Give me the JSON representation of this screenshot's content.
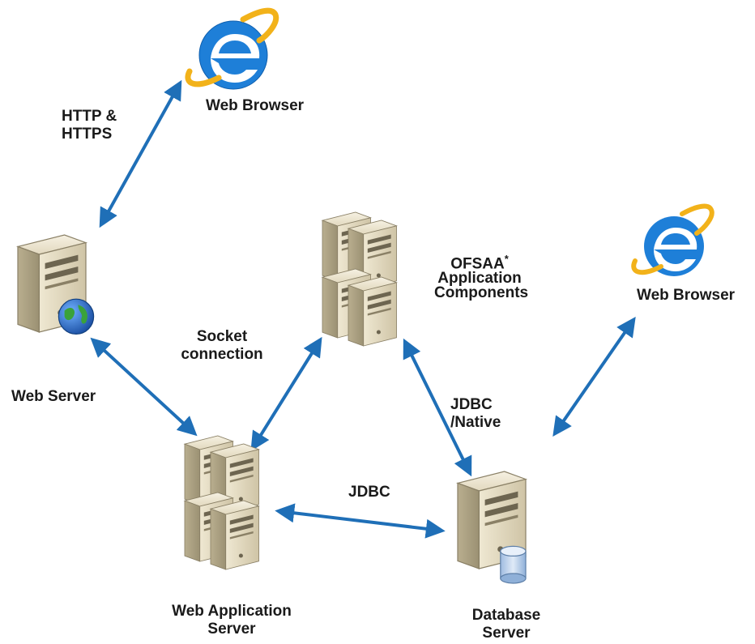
{
  "nodes": {
    "browser_top": {
      "label": "Web Browser",
      "icon": "internet-explorer-icon"
    },
    "browser_right": {
      "label": "Web Browser",
      "icon": "internet-explorer-icon"
    },
    "web_server": {
      "label": "Web Server",
      "icon": "web-server-globe-icon"
    },
    "ofsaa": {
      "label_line1": "OFSAA",
      "label_sup": "*",
      "label_line2": "Application",
      "label_line3": "Components",
      "icon": "server-cluster-icon"
    },
    "web_app_server": {
      "label_line1": "Web Application",
      "label_line2": "Server",
      "icon": "server-cluster-icon"
    },
    "db_server": {
      "label_line1": "Database",
      "label_line2": "Server",
      "icon": "database-server-icon"
    }
  },
  "connections": {
    "http": {
      "line1": "HTTP &",
      "line2": "HTTPS"
    },
    "socket": {
      "line1": "Socket",
      "line2": "connection"
    },
    "jdbc_native": {
      "line1": "JDBC",
      "line2": "/Native"
    },
    "jdbc": {
      "label": "JDBC"
    }
  },
  "colors": {
    "arrow": "#1f6fb7",
    "ie_blue": "#1e7fd8",
    "ie_ring": "#f2b21a",
    "server_body": "#d9cfb4",
    "server_dark": "#8a8066",
    "globe_green": "#3aa23a",
    "globe_blue": "#1f5fb7",
    "db_cyl": "#b7cde6"
  }
}
